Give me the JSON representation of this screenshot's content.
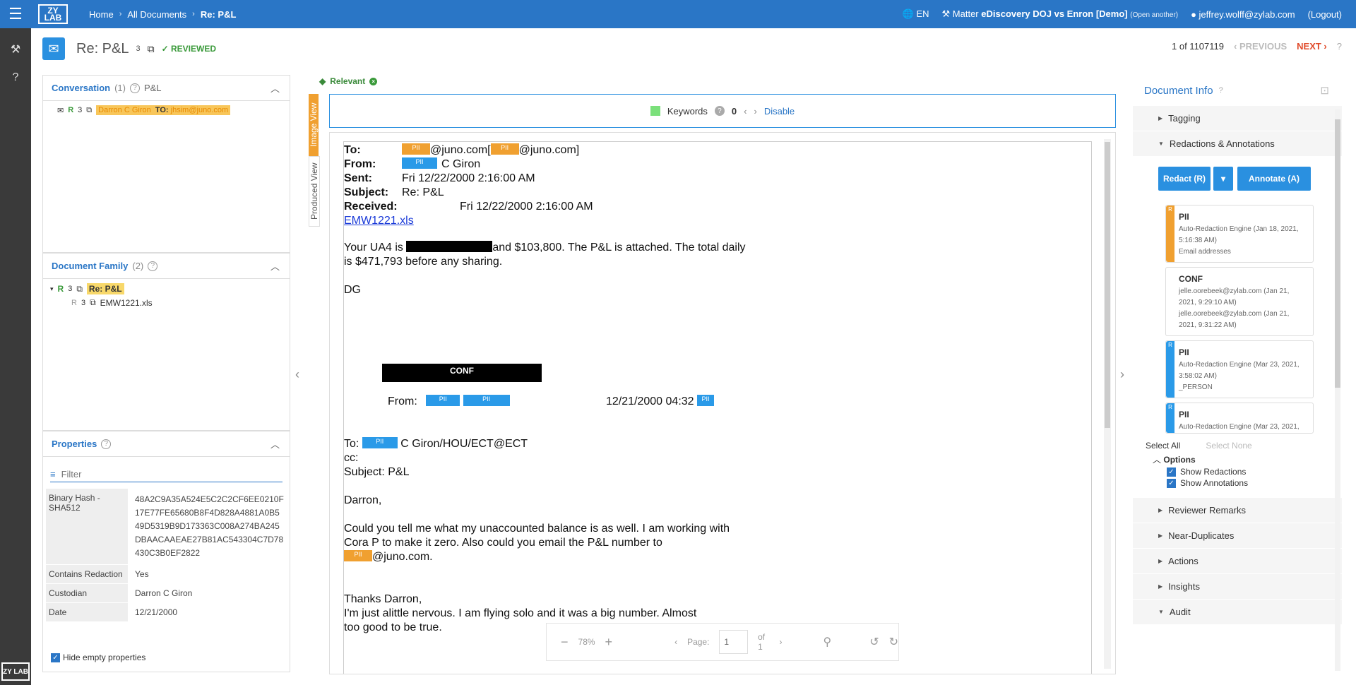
{
  "topbar": {
    "breadcrumbs": [
      "Home",
      "All Documents",
      "Re: P&L"
    ],
    "language": "EN",
    "matter_prefix": "Matter",
    "matter_name": "eDiscovery DOJ vs Enron [Demo]",
    "open_another": "(Open another)",
    "user": "jeffrey.wolff@zylab.com",
    "logout": "(Logout)",
    "logo": "ZY LAB"
  },
  "doc": {
    "title": "Re: P&L",
    "count": "3",
    "status": "REVIEWED",
    "position": "1 of 1107119",
    "prev": "PREVIOUS",
    "next": "NEXT"
  },
  "conversation": {
    "title": "Conversation",
    "count": "(1)",
    "subject": "P&L",
    "row": {
      "rating": "R",
      "num": "3",
      "from": "Darron C Giron",
      "to_label": "TO:",
      "to": "jhsim@juno.com"
    }
  },
  "family": {
    "title": "Document Family",
    "count": "(2)",
    "items": [
      {
        "rating": "R",
        "num": "3",
        "name": "Re: P&L"
      },
      {
        "rating": "R",
        "num": "3",
        "name": "EMW1221.xls"
      }
    ]
  },
  "properties": {
    "title": "Properties",
    "filter_placeholder": "Filter",
    "rows": [
      {
        "key": "Binary Hash - SHA512",
        "value": "48A2C9A35A524E5C2C2CF6EE0210F17E77FE65680B8F4D828A4881A0B549D5319B9D173363C008A274BA245DBAACAAEAE27B81AC543304C7D78430C3B0EF2822"
      },
      {
        "key": "Contains Redaction",
        "value": "Yes"
      },
      {
        "key": "Custodian",
        "value": "Darron C Giron"
      },
      {
        "key": "Date",
        "value": "12/21/2000"
      }
    ],
    "hide_empty": "Hide empty properties"
  },
  "viewer": {
    "tag": "Relevant",
    "tab_image": "Image View",
    "tab_produced": "Produced View",
    "keywords_label": "Keywords",
    "keywords_count": "0",
    "disable": "Disable",
    "zoom": "78%",
    "page_label": "Page:",
    "page_value": "1",
    "page_of": "of 1"
  },
  "email": {
    "to_label": "To:",
    "to_text1": "@juno.com[",
    "to_text2": "@juno.com]",
    "from_label": "From:",
    "from_text": "C Giron",
    "sent_label": "Sent:",
    "sent_text": "Fri 12/22/2000 2:16:00 AM",
    "subject_label": "Subject:",
    "subject_text": "Re: P&L",
    "received_label": "Received:",
    "received_text": "Fri 12/22/2000 2:16:00 AM",
    "attachment": "EMW1221.xls",
    "body1a": "Your UA4 is",
    "body1b": "and $103,800.  The P&L is attached.  The total daily",
    "body2": "is $471,793 before any sharing.",
    "sig": "DG",
    "conf": "CONF",
    "fwd_from": "From:",
    "fwd_date": "12/21/2000 04:32",
    "fwd_to_label": "To:",
    "fwd_to_text": "C Giron/HOU/ECT@ECT",
    "cc": "cc:",
    "fwd_subject": "Subject: P&L",
    "greet": "Darron,",
    "q1": "Could you tell me what my unaccounted balance is as well.  I am working with",
    "q2": "Cora P to make it zero.  Also could you email the P&L number to",
    "q3": "@juno.com.",
    "t1": "Thanks Darron,",
    "t2": "I'm just alittle nervous.  I am flying solo and it was a big number.  Almost",
    "t3": "too good to be true.",
    "pii": "PII"
  },
  "right": {
    "title": "Document Info",
    "sections_top": [
      "Tagging",
      "Redactions & Annotations"
    ],
    "redact_btn": "Redact (R)",
    "annotate_btn": "Annotate (A)",
    "cards": [
      {
        "badge": "R",
        "title": "PII",
        "lines": [
          "Auto-Redaction Engine (Jan 18, 2021, 5:16:38 AM)",
          "Email addresses"
        ],
        "color": "#f0a030"
      },
      {
        "badge": "",
        "title": "CONF",
        "lines": [
          "jelle.oorebeek@zylab.com (Jan 21, 2021, 9:29:10 AM)",
          "jelle.oorebeek@zylab.com (Jan 21, 2021, 9:31:22 AM)"
        ],
        "color": ""
      },
      {
        "badge": "R",
        "title": "PII",
        "lines": [
          "Auto-Redaction Engine (Mar 23, 2021, 3:58:02 AM)",
          "_PERSON"
        ],
        "color": "#2a9ae8"
      },
      {
        "badge": "R",
        "title": "PII",
        "lines": [
          "Auto-Redaction Engine (Mar 23, 2021,"
        ],
        "color": "#2a9ae8"
      }
    ],
    "select_all": "Select All",
    "select_none": "Select None",
    "options": "Options",
    "show_redactions": "Show Redactions",
    "show_annotations": "Show Annotations",
    "sections_bottom": [
      "Reviewer Remarks",
      "Near-Duplicates",
      "Actions",
      "Insights",
      "Audit"
    ]
  }
}
